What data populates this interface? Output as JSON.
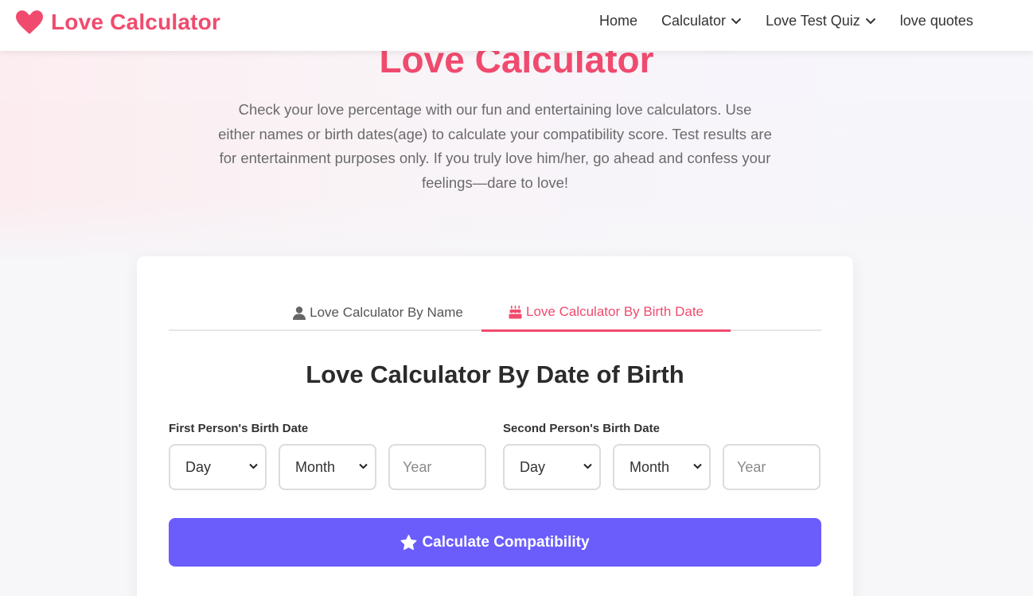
{
  "header": {
    "logo_text": "Love Calculator",
    "logo_icon": "heart-icon",
    "nav": [
      {
        "label": "Home",
        "has_dropdown": false
      },
      {
        "label": "Calculator",
        "has_dropdown": true
      },
      {
        "label": "Love Test Quiz",
        "has_dropdown": true
      },
      {
        "label": "love quotes",
        "has_dropdown": false
      }
    ]
  },
  "hero": {
    "title": "Love Calculator",
    "description": "Check your love percentage with our fun and entertaining love calculators. Use either names or birth dates(age) to calculate your compatibility score. Test results are for entertainment purposes only. If you truly love him/her, go ahead and confess your feelings—dare to love!"
  },
  "tabs": [
    {
      "label": "Love Calculator By Name",
      "icon": "user-icon",
      "active": false
    },
    {
      "label": "Love Calculator By Birth Date",
      "icon": "birthday-cake-icon",
      "active": true
    }
  ],
  "form": {
    "title": "Love Calculator By Date of Birth",
    "first_person": {
      "label": "First Person's Birth Date",
      "day": "Day",
      "month": "Month",
      "year_placeholder": "Year"
    },
    "second_person": {
      "label": "Second Person's Birth Date",
      "day": "Day",
      "month": "Month",
      "year_placeholder": "Year"
    },
    "submit_label": "Calculate Compatibility",
    "submit_icon": "star-icon"
  },
  "colors": {
    "brand": "#f04b6e",
    "button": "#6a5dfc",
    "text": "#333333",
    "muted": "#6b6b6b"
  }
}
